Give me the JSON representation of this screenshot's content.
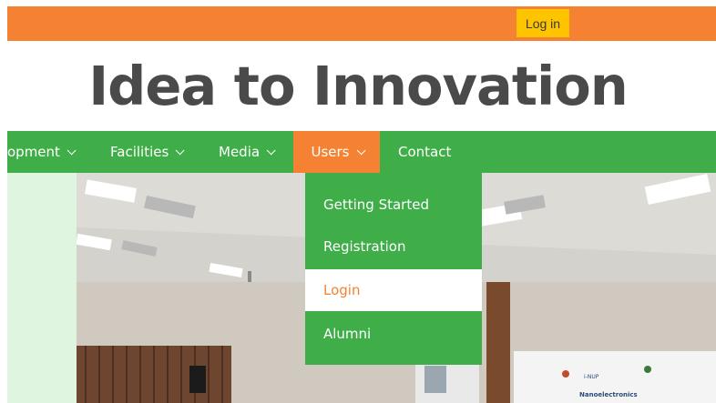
{
  "topbar": {
    "login_label": "Log in"
  },
  "site": {
    "title": "Idea to Innovation"
  },
  "nav": {
    "items": [
      {
        "label": "opment"
      },
      {
        "label": "Facilities"
      },
      {
        "label": "Media"
      },
      {
        "label": "Users"
      },
      {
        "label": "Contact"
      }
    ]
  },
  "dropdown": {
    "items": [
      {
        "label": "Getting Started"
      },
      {
        "label": "Registration"
      },
      {
        "label": "Login"
      },
      {
        "label": "Alumni"
      }
    ]
  },
  "hero": {
    "poster_line1": "i-NUP",
    "poster_line2": "Nanoelectronics"
  },
  "colors": {
    "orange": "#f58233",
    "green": "#3fae49",
    "yellow": "#ffc400",
    "title_gray": "#4a4a4a"
  }
}
